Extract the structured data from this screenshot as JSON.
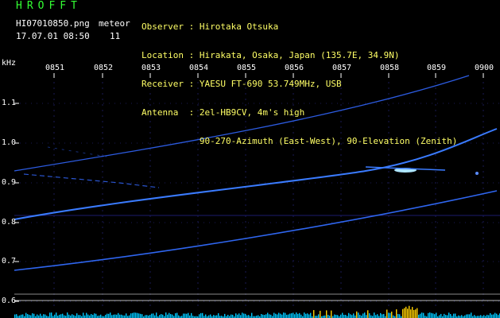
{
  "header": {
    "logo": "HROFFT",
    "filename": "HI07010850.png",
    "meteor_label": "meteor",
    "datetime": "17.07.01 08:50",
    "meteor_count": "11"
  },
  "info": {
    "lines": [
      "Observer : Hirotaka Otsuka",
      "Location : Hirakata, Osaka, Japan (135.7E, 34.9N)",
      "Receiver : YAESU FT-690 53.749MHz, USB",
      "Antenna  : 2el-HB9CV, 4m's high",
      "           90-270-Azimuth (East-West), 90-Elevation (Zenith)"
    ]
  },
  "axis": {
    "unit": "kHz",
    "y_ticks": [
      "1.1",
      "1.0",
      "0.9",
      "0.8",
      "0.7",
      "0.6"
    ],
    "x_ticks": [
      "0851",
      "0852",
      "0853",
      "0854",
      "0855",
      "0856",
      "0857",
      "0858",
      "0859",
      "0900"
    ]
  },
  "colors": {
    "background": "#000000",
    "grid": "#1a1a55",
    "trace": "#3a7bff",
    "trace_bright": "#9ad8ff",
    "baseline": "#00c8ff",
    "burst": "#ffd000"
  }
}
